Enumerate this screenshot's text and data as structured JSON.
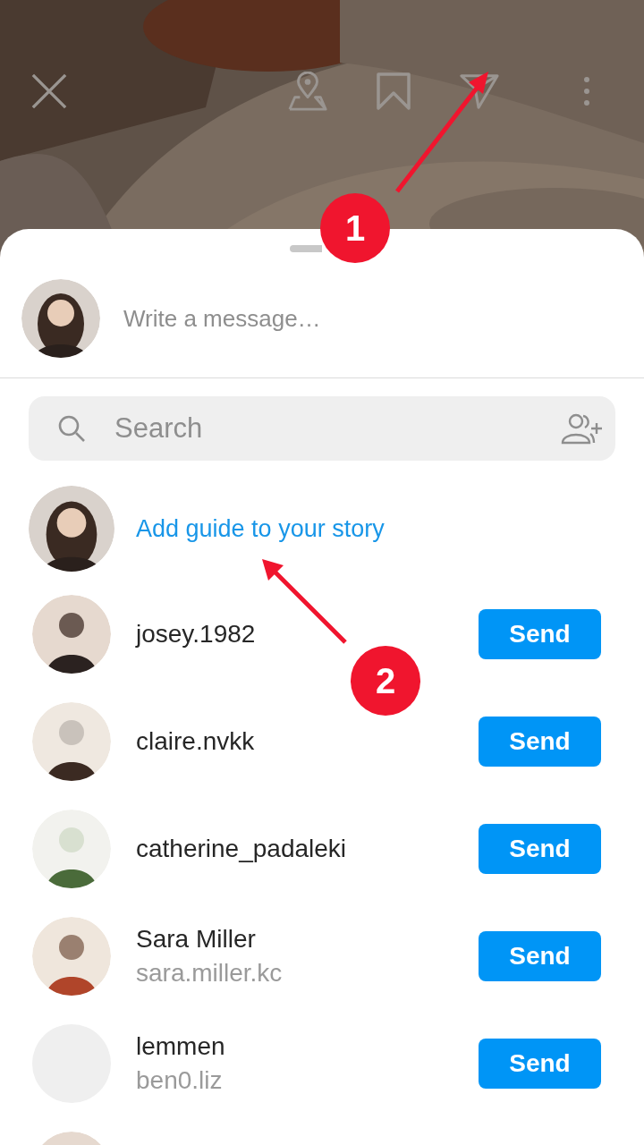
{
  "header": {
    "icons": [
      {
        "kind": "close"
      },
      {
        "kind": "location"
      },
      {
        "kind": "bookmark"
      },
      {
        "kind": "share"
      },
      {
        "kind": "more"
      }
    ]
  },
  "composer": {
    "avatar": {
      "kind": "picture"
    },
    "placeholder": "Write a message…"
  },
  "search": {
    "placeholder": "Search"
  },
  "story": {
    "avatar": {
      "kind": "picture"
    },
    "label": "Add guide to your story"
  },
  "contacts": [
    {
      "avatar": {
        "kind": "picture"
      },
      "name": "josey.1982",
      "button": "Send"
    },
    {
      "avatar": {
        "kind": "picture"
      },
      "name": "claire.nvkk",
      "button": "Send"
    },
    {
      "avatar": {
        "kind": "picture"
      },
      "name": "catherine_padaleki",
      "button": "Send"
    },
    {
      "avatar": {
        "kind": "picture"
      },
      "name": "Sara Miller",
      "username": "sara.miller.kc",
      "button": "Send"
    },
    {
      "avatar": {
        "kind": "blank"
      },
      "name": "lemmen",
      "username": "ben0.liz",
      "button": "Send"
    },
    {
      "avatar": {
        "kind": "picture"
      }
    }
  ],
  "annotations": [
    {
      "label": "1"
    },
    {
      "label": "2"
    }
  ]
}
